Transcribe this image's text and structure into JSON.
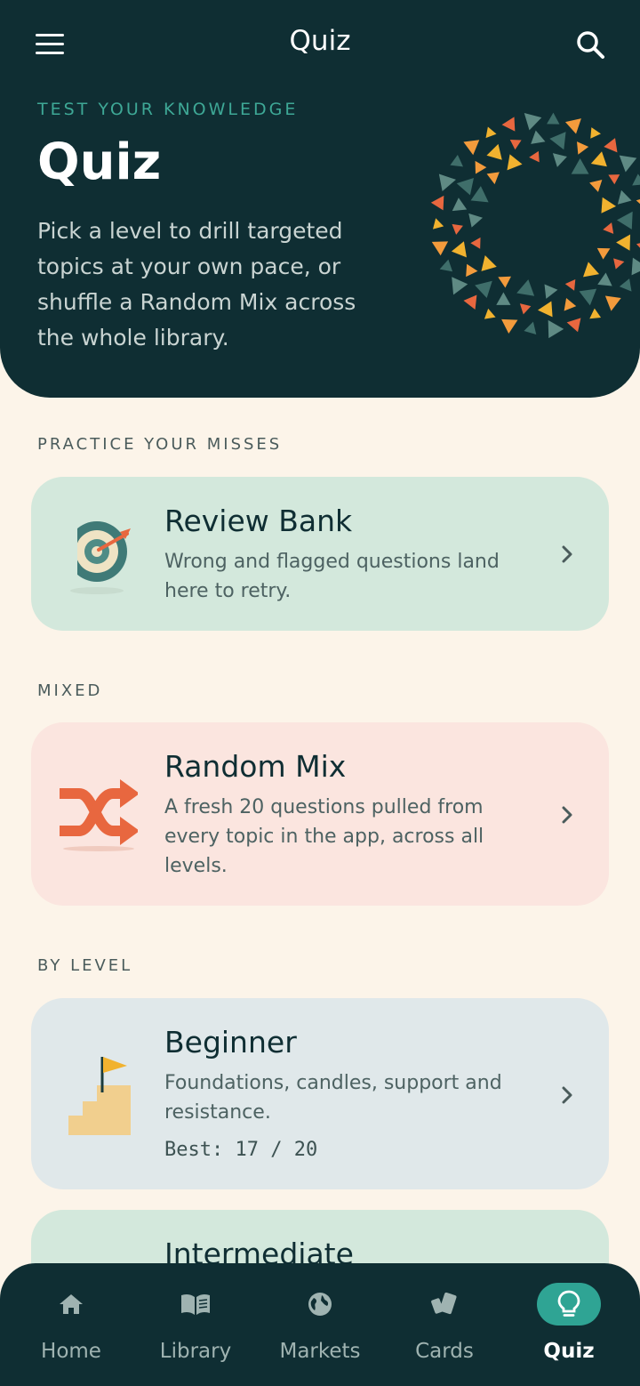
{
  "app": {
    "title": "Quiz"
  },
  "hero": {
    "kicker": "TEST YOUR KNOWLEDGE",
    "title": "Quiz",
    "description": "Pick a level to drill targeted topics at your own pace, or shuffle a Random Mix across the whole library."
  },
  "sections": {
    "misses": "PRACTICE YOUR MISSES",
    "mixed": "MIXED",
    "by_level": "BY LEVEL"
  },
  "cards": {
    "review": {
      "title": "Review Bank",
      "description": "Wrong and flagged questions land here to retry.",
      "bg": "#d3e8dc"
    },
    "random": {
      "title": "Random Mix",
      "description": "A fresh 20 questions pulled from every topic in the app, across all levels.",
      "bg": "#fbe5df"
    },
    "beginner": {
      "title": "Beginner",
      "description": "Foundations, candles, support and resistance.",
      "best": "Best: 17 / 20",
      "bg": "#e0e8ea"
    },
    "intermediate": {
      "title": "Intermediate",
      "bg": "#d3e8dc"
    }
  },
  "nav": {
    "items": [
      {
        "label": "Home",
        "icon": "home-icon"
      },
      {
        "label": "Library",
        "icon": "book-icon"
      },
      {
        "label": "Markets",
        "icon": "globe-icon"
      },
      {
        "label": "Cards",
        "icon": "cards-icon"
      },
      {
        "label": "Quiz",
        "icon": "lightbulb-icon",
        "active": true
      }
    ]
  },
  "colors": {
    "hero_bg": "#0f2e33",
    "page_bg": "#fcf4e9",
    "accent_teal": "#2fa494",
    "accent_orange": "#e8673f",
    "accent_yellow": "#f1b22f"
  }
}
